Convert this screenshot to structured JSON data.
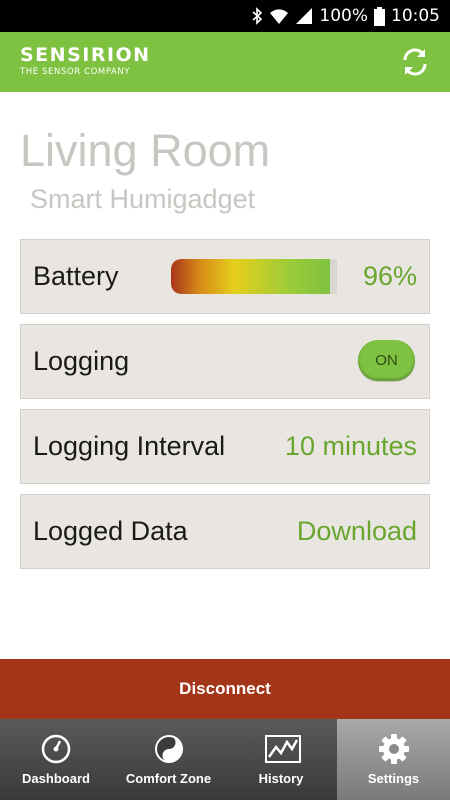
{
  "status_bar": {
    "battery_percent": "100%",
    "time": "10:05",
    "icons": [
      "bluetooth-icon",
      "wifi-icon",
      "signal-icon",
      "battery-icon"
    ]
  },
  "header": {
    "brand": "SENSIRION",
    "tagline": "THE SENSOR COMPANY",
    "refresh_icon": "refresh-icon",
    "color": "#7fc241"
  },
  "page": {
    "title": "Living Room",
    "subtitle": "Smart Humigadget"
  },
  "settings": {
    "battery": {
      "label": "Battery",
      "value": "96%",
      "level": 0.96
    },
    "logging": {
      "label": "Logging",
      "toggle": "ON"
    },
    "logging_interval": {
      "label": "Logging Interval",
      "value": "10 minutes"
    },
    "logged_data": {
      "label": "Logged Data",
      "action": "Download"
    }
  },
  "disconnect": {
    "label": "Disconnect",
    "color": "#a33618"
  },
  "bottom_nav": {
    "items": [
      {
        "label": "Dashboard",
        "icon": "gauge-icon"
      },
      {
        "label": "Comfort Zone",
        "icon": "yin-yang-icon"
      },
      {
        "label": "History",
        "icon": "chart-icon"
      },
      {
        "label": "Settings",
        "icon": "gear-icon",
        "active": true
      }
    ]
  },
  "colors": {
    "accent": "#7fc241",
    "value_text": "#6aa62e",
    "row_bg": "#e9e6e2"
  }
}
